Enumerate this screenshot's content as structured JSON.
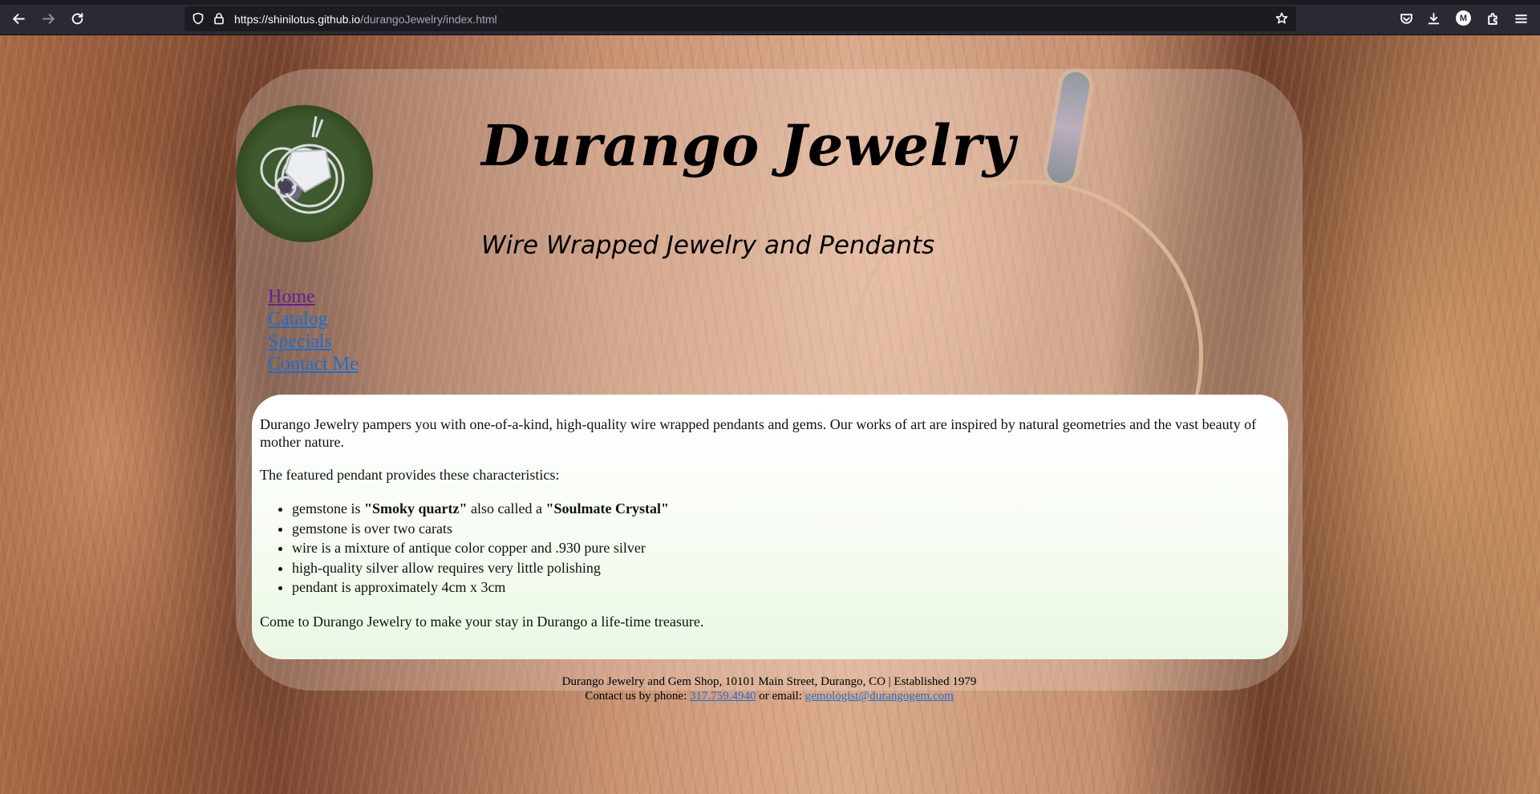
{
  "browser": {
    "url_host": "https://shinilotus.github.io",
    "url_path": "/durangoJewelry/index.html",
    "profile_initial": "M"
  },
  "header": {
    "title": "Durango Jewelry",
    "subtitle": "Wire Wrapped Jewelry and Pendants"
  },
  "nav": {
    "items": [
      "Home",
      "Catalog",
      "Specials",
      "Contact Me"
    ]
  },
  "main": {
    "intro": "Durango Jewelry pampers you with one-of-a-kind, high-quality wire wrapped pendants and gems. Our works of art are inspired by natural geometries and the vast beauty of mother nature.",
    "featured_lead": "The featured pendant provides these characteristics:",
    "list": {
      "item1_prefix": "gemstone is ",
      "item1_bold1": "\"Smoky quartz\"",
      "item1_mid": " also called a ",
      "item1_bold2": "\"Soulmate Crystal\"",
      "item2": "gemstone is over two carats",
      "item3": "wire is a mixture of antique color copper and .930 pure silver",
      "item4": "high-quality silver allow requires very little polishing",
      "item5": "pendant is approximately 4cm x 3cm"
    },
    "closing": "Come to Durango Jewelry to make your stay in Durango a life-time treasure."
  },
  "footer": {
    "line1": "Durango Jewelry and Gem Shop, 10101 Main Street, Durango, CO | Established 1979",
    "contact_prefix": "Contact us by phone: ",
    "phone": "317.759.4940",
    "email_prefix": " or email: ",
    "email": "gemologist@durangogem.com"
  },
  "colors": {
    "link": "#1a6fd1",
    "visited_link": "#6a1b9a",
    "chrome_bg": "#2b2a33"
  }
}
